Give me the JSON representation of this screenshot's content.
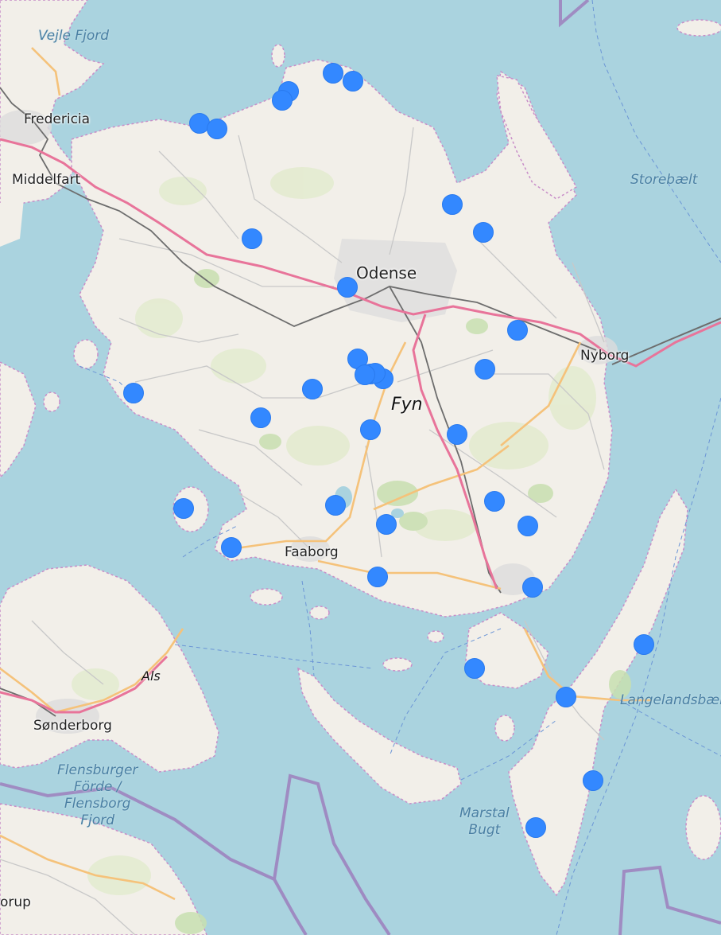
{
  "map": {
    "colors": {
      "water": "#aad3df",
      "land": "#f2efe9",
      "field": "#e3ebcf",
      "forest": "#c8dfb0",
      "urban": "#dcdcdc",
      "motorway": "#e8749a",
      "primary": "#f5c27a",
      "road": "#c8c8c8",
      "rail": "#6d6d6d",
      "border": "#9d7fbd",
      "coast_dash": "#c88ec8",
      "marker": "#3388ff"
    },
    "labels": {
      "odense": "Odense",
      "fyn": "Fyn",
      "nyborg": "Nyborg",
      "faaborg": "Faaborg",
      "fredericia": "Fredericia",
      "middelfart": "Middelfart",
      "sonderborg": "Sønderborg",
      "als": "Als",
      "vejle_fjord": "Vejle Fjord",
      "storebaelt": "Storebælt",
      "langelandsbaelt": "Langelandsbælt",
      "marstal_bugt": "Marstal\nBugt",
      "flensburger_forde": "Flensburger\nFörde /\nFlensborg\nFjord",
      "borup_partial": "orup"
    },
    "markers": [
      {
        "id": "m1"
      },
      {
        "id": "m2"
      },
      {
        "id": "m3"
      },
      {
        "id": "m4"
      },
      {
        "id": "m5"
      },
      {
        "id": "m6"
      },
      {
        "id": "m7"
      },
      {
        "id": "m8"
      },
      {
        "id": "m9"
      },
      {
        "id": "m10"
      },
      {
        "id": "m11"
      },
      {
        "id": "m12"
      },
      {
        "id": "m13"
      },
      {
        "id": "m14"
      },
      {
        "id": "m15"
      },
      {
        "id": "m16"
      },
      {
        "id": "m17"
      },
      {
        "id": "m18"
      },
      {
        "id": "m19"
      },
      {
        "id": "m20"
      },
      {
        "id": "m21"
      },
      {
        "id": "m22"
      },
      {
        "id": "m23"
      },
      {
        "id": "m24"
      },
      {
        "id": "m25"
      },
      {
        "id": "m26"
      },
      {
        "id": "m27"
      },
      {
        "id": "m28"
      },
      {
        "id": "m29"
      },
      {
        "id": "m30"
      },
      {
        "id": "m31"
      },
      {
        "id": "m32"
      },
      {
        "id": "m33"
      },
      {
        "id": "m34"
      },
      {
        "id": "m35"
      }
    ]
  }
}
